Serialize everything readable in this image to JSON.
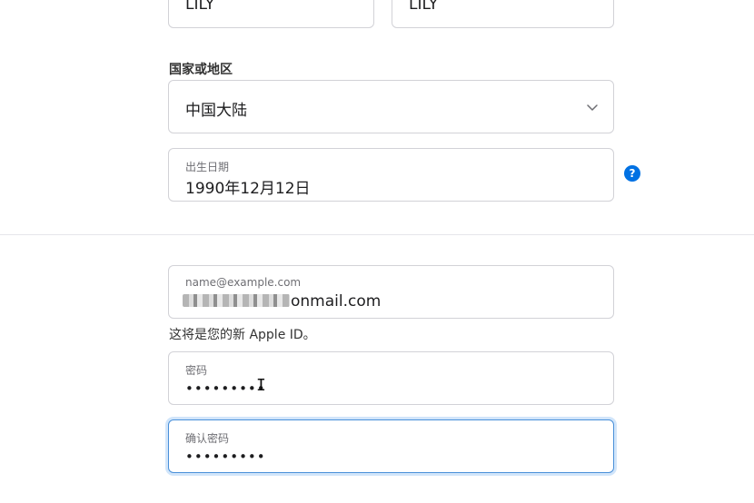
{
  "name_fields": {
    "first_name": "LILY",
    "last_name": "LILY"
  },
  "country": {
    "label": "国家或地区",
    "value": "中国大陆"
  },
  "birthdate": {
    "label": "出生日期",
    "value": "1990年12月12日",
    "help": "?"
  },
  "email": {
    "placeholder": "name@example.com",
    "value_suffix": "onmail.com",
    "hint": "这将是您的新 Apple ID。"
  },
  "password": {
    "label": "密码",
    "value": "•••••••••"
  },
  "confirm_password": {
    "label": "确认密码",
    "value": "•••••••••"
  },
  "colors": {
    "accent": "#0071e3",
    "focus_border": "#4a90d9",
    "border": "#d2d2d7"
  }
}
